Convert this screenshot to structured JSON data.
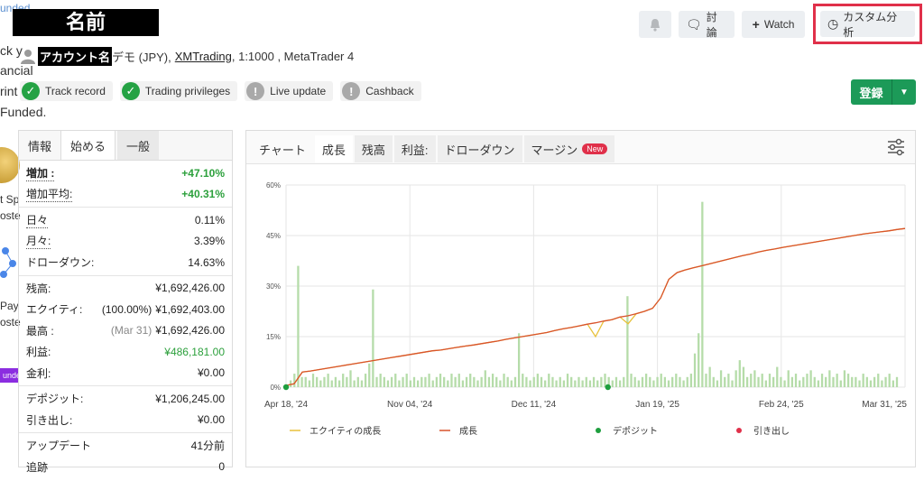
{
  "clipped_left": {
    "line1": "unded",
    "line2": "ck y",
    "line3": "ancial",
    "line4": "rint",
    "line5": "Funded.",
    "line6": "t Sp",
    "line7": "oste",
    "line8": "Pay",
    "line9": "oste",
    "line10": "unded"
  },
  "header": {
    "title": "名前",
    "account_name": "アカウント名",
    "account_info": "デモ (JPY),",
    "broker": "XMTrading",
    "account_rest": ", 1:1000 , MetaTrader 4"
  },
  "badges": [
    {
      "label": "Track record",
      "status": "ok"
    },
    {
      "label": "Trading privileges",
      "status": "ok"
    },
    {
      "label": "Live update",
      "status": "warn"
    },
    {
      "label": "Cashback",
      "status": "warn"
    }
  ],
  "top_buttons": {
    "discuss": "討論",
    "watch": "Watch",
    "custom_analysis": "カスタム分析"
  },
  "register_button": "登録",
  "stats_tabs": [
    "情報",
    "始める",
    "一般"
  ],
  "stats": {
    "gain_label": "増加 :",
    "gain_value": "+47.10%",
    "avg_gain_label": "増加平均:",
    "avg_gain_value": "+40.31%",
    "daily_label": "日々",
    "daily_value": "0.11%",
    "monthly_label": "月々:",
    "monthly_value": "3.39%",
    "drawdown_label": "ドローダウン:",
    "drawdown_value": "14.63%",
    "balance_label": "残高:",
    "balance_value": "¥1,692,426.00",
    "equity_label": "エクイティ:",
    "equity_pct": "(100.00%)",
    "equity_value": "¥1,692,403.00",
    "highest_label": "最高 :",
    "highest_date": "(Mar 31)",
    "highest_value": "¥1,692,426.00",
    "profit_label": "利益:",
    "profit_value": "¥486,181.00",
    "interest_label": "金利:",
    "interest_value": "¥0.00",
    "deposits_label": "デポジット:",
    "deposits_value": "¥1,206,245.00",
    "withdrawals_label": "引き出し:",
    "withdrawals_value": "¥0.00",
    "updated_label": "アップデート",
    "updated_value": "41分前",
    "tracking_label": "追跡",
    "tracking_value": "0"
  },
  "chart_tabs": {
    "chart": "チャート",
    "growth": "成長",
    "balance": "残高",
    "profit": "利益:",
    "drawdown": "ドローダウン",
    "margin": "マージン",
    "new": "New"
  },
  "colors": {
    "growth_line": "#d9532c",
    "equity_line": "#e8c13a",
    "bars": "#b5dca9",
    "deposit_dot": "#1e9e3e",
    "withdrawal_dot": "#e0304a",
    "highlight_border": "#e0304a",
    "register_green": "#1c9a58"
  },
  "chart_data": {
    "type": "line",
    "y_ticks": [
      "0%",
      "15%",
      "30%",
      "45%",
      "60%"
    ],
    "ylim": [
      0,
      60
    ],
    "x_ticks": [
      "Apr 18, '24",
      "Nov 04, '24",
      "Dec 11, '24",
      "Jan 19, '25",
      "Feb 24, '25",
      "Mar 31, '25"
    ],
    "legend": [
      {
        "name": "エクイティの成長",
        "type": "line",
        "color": "#e8c13a"
      },
      {
        "name": "成長",
        "type": "line",
        "color": "#d9532c"
      },
      {
        "name": "デポジット",
        "type": "dot",
        "color": "#1e9e3e"
      },
      {
        "name": "引き出し",
        "type": "dot",
        "color": "#e0304a"
      }
    ],
    "growth_series": {
      "name": "成長",
      "values": [
        0.5,
        1.0,
        4.5,
        4.8,
        5.2,
        5.6,
        6.0,
        6.4,
        6.8,
        7.2,
        7.6,
        8.0,
        8.4,
        8.8,
        9.2,
        9.6,
        10.0,
        10.4,
        10.8,
        11.0,
        11.4,
        11.8,
        12.2,
        12.5,
        12.9,
        13.3,
        13.7,
        14.2,
        14.6,
        15.0,
        15.4,
        15.8,
        16.2,
        16.8,
        17.3,
        17.7,
        18.2,
        18.7,
        19.1,
        19.6,
        20.0,
        20.8,
        21.2,
        21.8,
        22.5,
        23.4,
        26.5,
        32.0,
        34.0,
        34.8,
        35.4,
        36.0,
        36.6,
        37.2,
        37.8,
        38.4,
        39.0,
        39.5,
        40.1,
        40.6,
        41.0,
        41.5,
        41.9,
        42.3,
        42.7,
        43.1,
        43.5,
        43.9,
        44.3,
        44.7,
        45.1,
        45.5,
        45.8,
        46.1,
        46.4,
        46.8,
        47.1
      ]
    },
    "equity_series": {
      "name": "エクイティの成長",
      "values": [
        0.5,
        1.0,
        4.5,
        4.8,
        5.2,
        5.6,
        6.0,
        6.4,
        6.8,
        7.2,
        7.6,
        8.0,
        8.4,
        8.8,
        9.2,
        9.6,
        10.0,
        10.4,
        10.8,
        11.0,
        11.4,
        11.8,
        12.2,
        12.5,
        12.9,
        13.3,
        13.7,
        14.2,
        14.6,
        15.0,
        15.4,
        15.8,
        16.2,
        16.8,
        17.3,
        17.7,
        18.2,
        18.7,
        15.0,
        19.6,
        20.0,
        20.8,
        18.8,
        21.8,
        22.5,
        23.4,
        26.5,
        32.0,
        34.0,
        34.8,
        35.4,
        36.0,
        36.6,
        37.2,
        37.8,
        38.4,
        39.0,
        39.5,
        40.1,
        40.6,
        41.0,
        41.5,
        41.9,
        42.3,
        42.7,
        43.1,
        43.5,
        43.9,
        44.3,
        44.7,
        45.1,
        45.5,
        45.8,
        46.1,
        46.4,
        46.8,
        47.1
      ]
    },
    "bar_values": [
      2,
      4,
      36,
      3,
      3,
      2,
      4,
      3,
      2,
      3,
      4,
      2,
      3,
      2,
      4,
      3,
      5,
      2,
      3,
      2,
      4,
      7,
      29,
      3,
      4,
      3,
      2,
      3,
      4,
      2,
      3,
      4,
      2,
      3,
      2,
      3,
      3,
      4,
      2,
      3,
      4,
      3,
      2,
      4,
      3,
      4,
      2,
      3,
      4,
      3,
      2,
      3,
      5,
      3,
      4,
      3,
      2,
      4,
      3,
      2,
      3,
      16,
      4,
      3,
      2,
      3,
      4,
      3,
      2,
      4,
      3,
      2,
      3,
      2,
      4,
      3,
      2,
      3,
      2,
      3,
      2,
      3,
      2,
      3,
      4,
      3,
      2,
      3,
      2,
      3,
      27,
      4,
      3,
      2,
      3,
      4,
      3,
      2,
      3,
      4,
      3,
      2,
      3,
      4,
      3,
      2,
      3,
      4,
      10,
      16,
      55,
      4,
      6,
      3,
      2,
      5,
      3,
      4,
      2,
      5,
      8,
      6,
      3,
      4,
      5,
      3,
      4,
      2,
      4,
      3,
      6,
      3,
      2,
      5,
      3,
      4,
      2,
      3,
      4,
      5,
      3,
      2,
      4,
      3,
      5,
      3,
      4,
      2,
      5,
      4,
      3,
      3,
      2,
      4,
      3,
      2,
      3,
      4,
      2,
      3,
      4,
      2,
      3
    ],
    "deposit_points": [
      0,
      0.52
    ]
  }
}
